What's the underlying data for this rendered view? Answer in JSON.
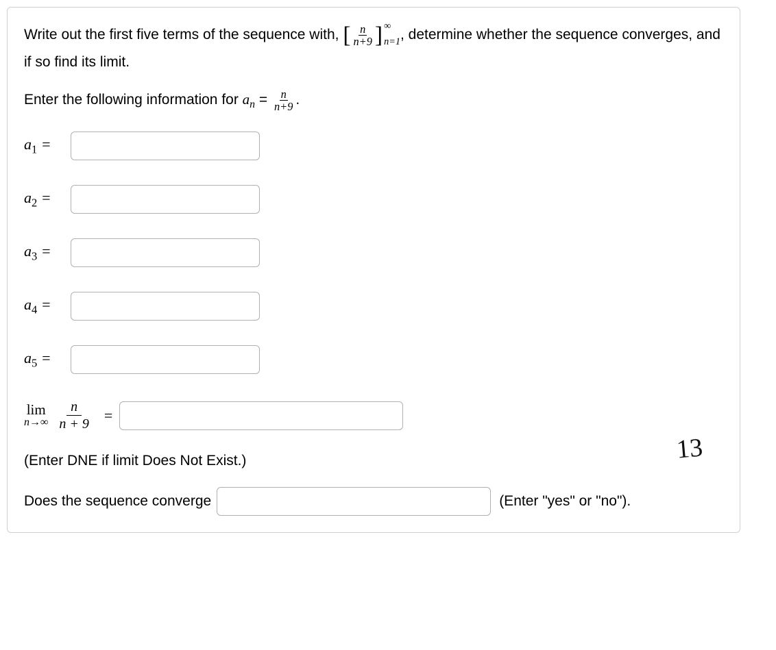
{
  "problem": {
    "text_before_formula": "Write out the first five terms of the sequence with, ",
    "text_after_formula": ", determine whether the sequence converges, and if so find its limit.",
    "formula_num": "n",
    "formula_den": "n+9",
    "formula_sup": "∞",
    "formula_sub": "n=1"
  },
  "subinstruction": {
    "text_before": "Enter the following information for ",
    "an_var": "a",
    "an_subscript": "n",
    "equals": " = ",
    "inline_num": "n",
    "inline_den": "n+9",
    "period": "."
  },
  "terms": [
    {
      "label_var": "a",
      "label_sub": "1",
      "equals": " ="
    },
    {
      "label_var": "a",
      "label_sub": "2",
      "equals": " ="
    },
    {
      "label_var": "a",
      "label_sub": "3",
      "equals": " ="
    },
    {
      "label_var": "a",
      "label_sub": "4",
      "equals": " ="
    },
    {
      "label_var": "a",
      "label_sub": "5",
      "equals": " ="
    }
  ],
  "limit": {
    "lim_text": "lim",
    "lim_sub": "n→∞",
    "frac_num": "n",
    "frac_den": "n + 9",
    "equals": "="
  },
  "dne_note": "(Enter DNE if limit Does Not Exist.)",
  "converge": {
    "question": "Does the sequence converge",
    "hint": "(Enter \"yes\" or \"no\")."
  },
  "handwritten": "13"
}
